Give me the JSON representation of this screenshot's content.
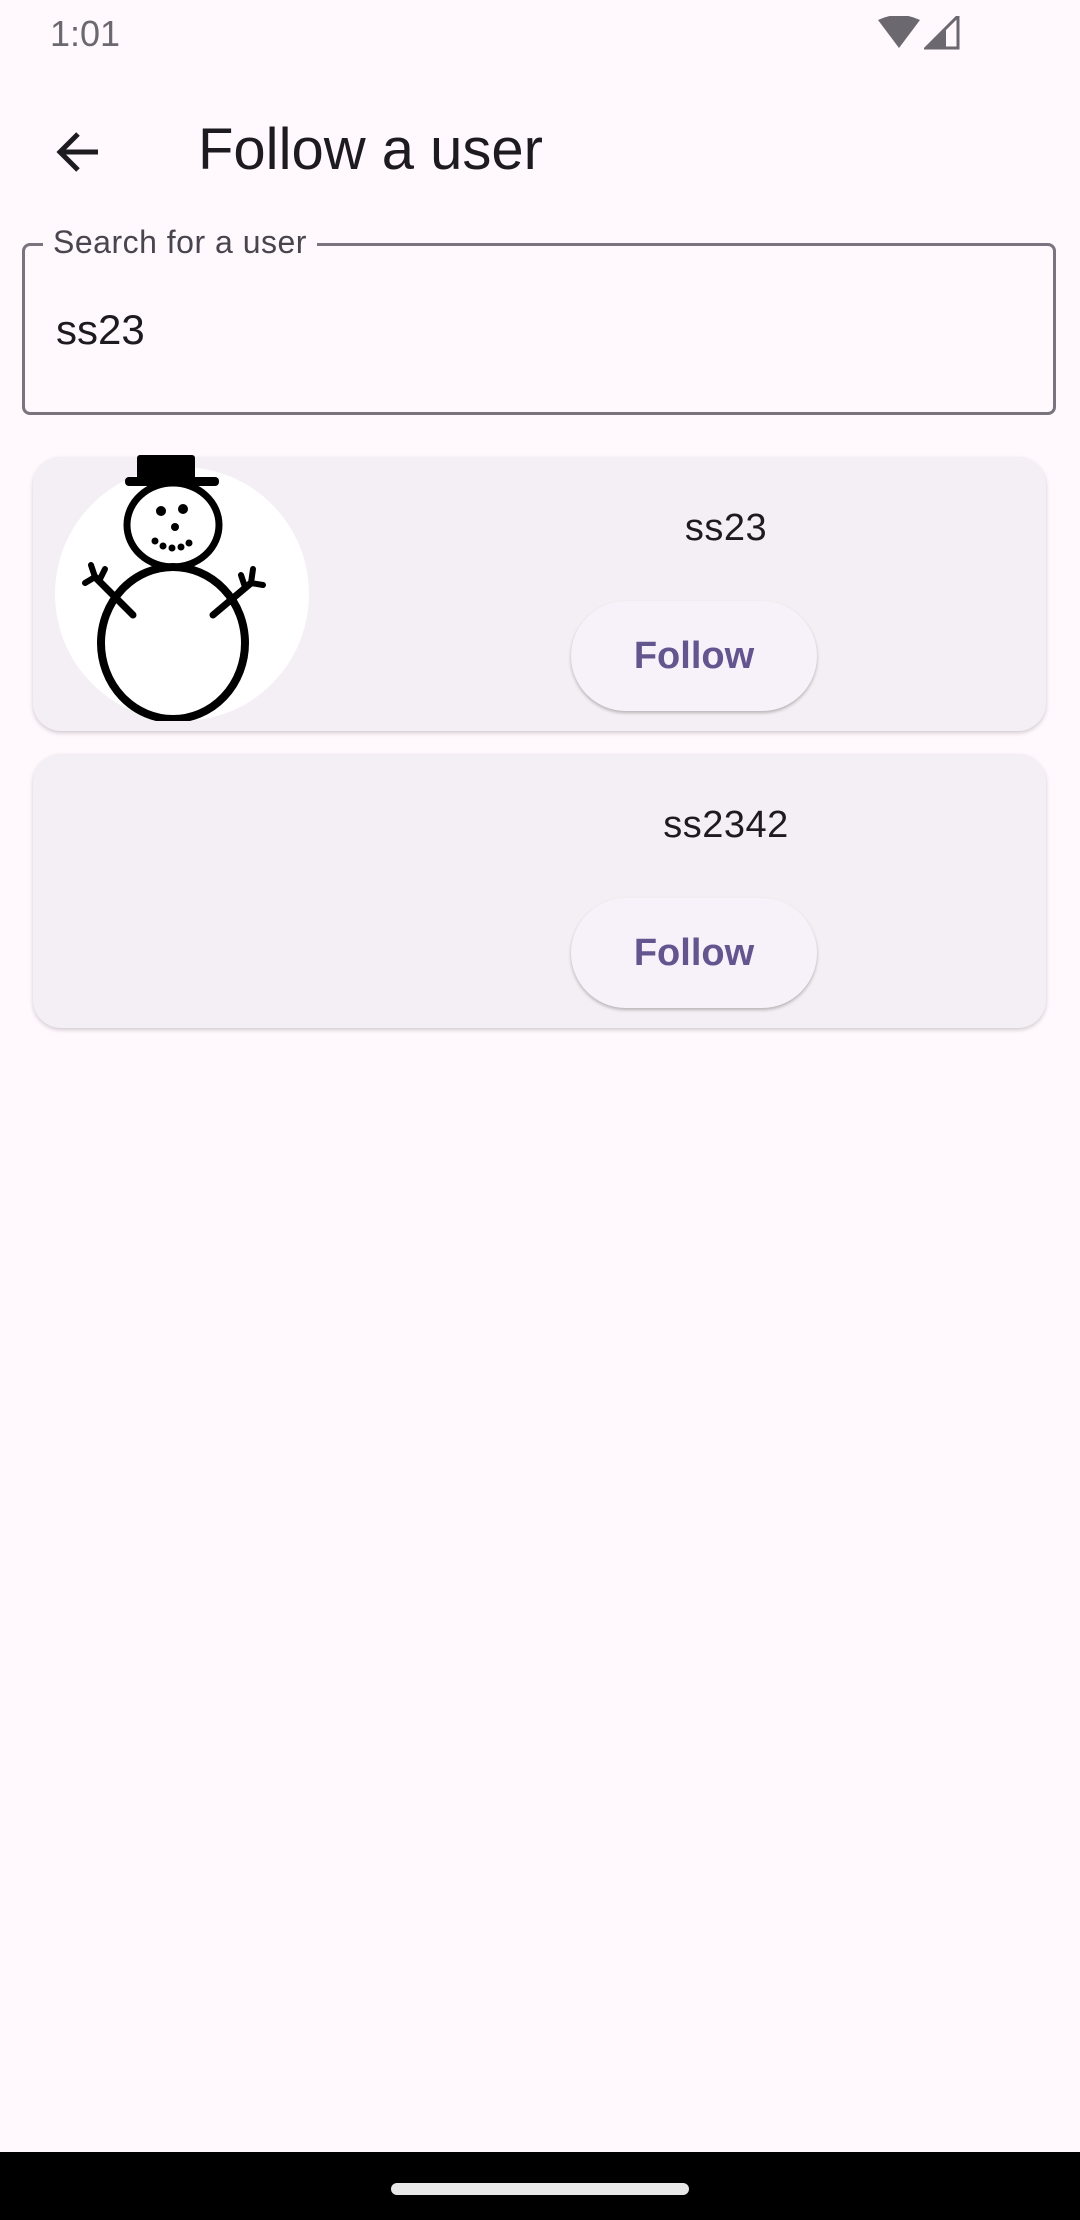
{
  "status_bar": {
    "time": "1:01",
    "icons": [
      "wifi-icon",
      "cellular-signal-icon"
    ]
  },
  "app_bar": {
    "back_icon": "arrow-back-icon",
    "title": "Follow a user"
  },
  "search": {
    "label": "Search for a user",
    "value": "ss23"
  },
  "results": [
    {
      "username": "ss23",
      "has_avatar": true,
      "avatar_image": "snowman-drawing",
      "follow_label": "Follow"
    },
    {
      "username": "ss2342",
      "has_avatar": false,
      "follow_label": "Follow"
    }
  ],
  "colors": {
    "background": "#FFF8FC",
    "card": "#F4EFF4",
    "accent": "#65558F",
    "outline": "#79747E",
    "text": "#1D1B20"
  }
}
